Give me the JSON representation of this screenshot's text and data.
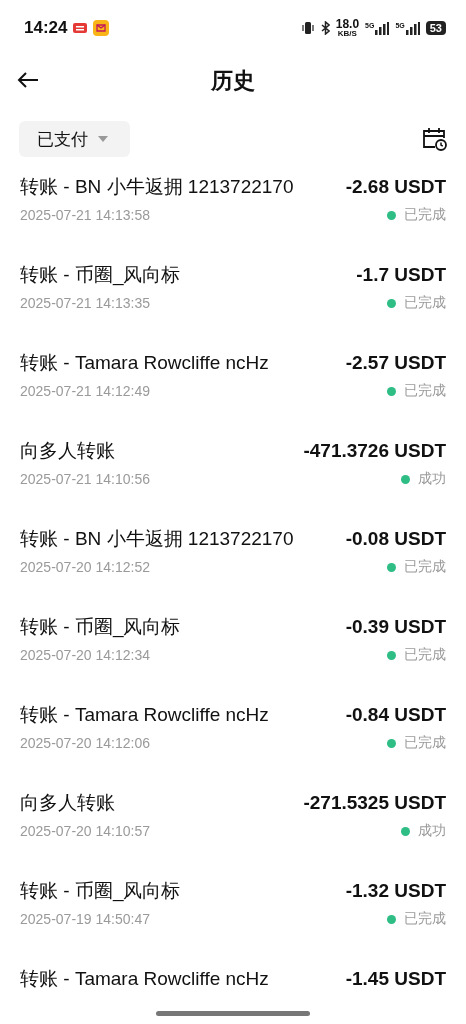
{
  "status_bar": {
    "time": "14:24",
    "net_speed": "18.0",
    "net_unit": "KB/S",
    "battery": "53",
    "signals": [
      "5G",
      "5G"
    ]
  },
  "header": {
    "title": "历史"
  },
  "filter": {
    "label": "已支付"
  },
  "transactions": [
    {
      "title": "转账 - BN 小牛返拥 1213722170",
      "amount": "-2.68 USDT",
      "time": "2025-07-21 14:13:58",
      "status": "已完成",
      "color": "#2ebd85"
    },
    {
      "title": "转账 - 币圈_风向标",
      "amount": "-1.7 USDT",
      "time": "2025-07-21 14:13:35",
      "status": "已完成",
      "color": "#2ebd85"
    },
    {
      "title": "转账 - Tamara Rowcliffe ncHz",
      "amount": "-2.57 USDT",
      "time": "2025-07-21 14:12:49",
      "status": "已完成",
      "color": "#2ebd85"
    },
    {
      "title": "向多人转账",
      "amount": "-471.3726 USDT",
      "time": "2025-07-21 14:10:56",
      "status": "成功",
      "color": "#2ebd85"
    },
    {
      "title": "转账 - BN 小牛返拥 1213722170",
      "amount": "-0.08 USDT",
      "time": "2025-07-20 14:12:52",
      "status": "已完成",
      "color": "#2ebd85"
    },
    {
      "title": "转账 - 币圈_风向标",
      "amount": "-0.39 USDT",
      "time": "2025-07-20 14:12:34",
      "status": "已完成",
      "color": "#2ebd85"
    },
    {
      "title": "转账 - Tamara Rowcliffe ncHz",
      "amount": "-0.84 USDT",
      "time": "2025-07-20 14:12:06",
      "status": "已完成",
      "color": "#2ebd85"
    },
    {
      "title": "向多人转账",
      "amount": "-271.5325 USDT",
      "time": "2025-07-20 14:10:57",
      "status": "成功",
      "color": "#2ebd85"
    },
    {
      "title": "转账 - 币圈_风向标",
      "amount": "-1.32 USDT",
      "time": "2025-07-19 14:50:47",
      "status": "已完成",
      "color": "#2ebd85"
    },
    {
      "title": "转账 - Tamara Rowcliffe ncHz",
      "amount": "-1.45 USDT"
    }
  ]
}
